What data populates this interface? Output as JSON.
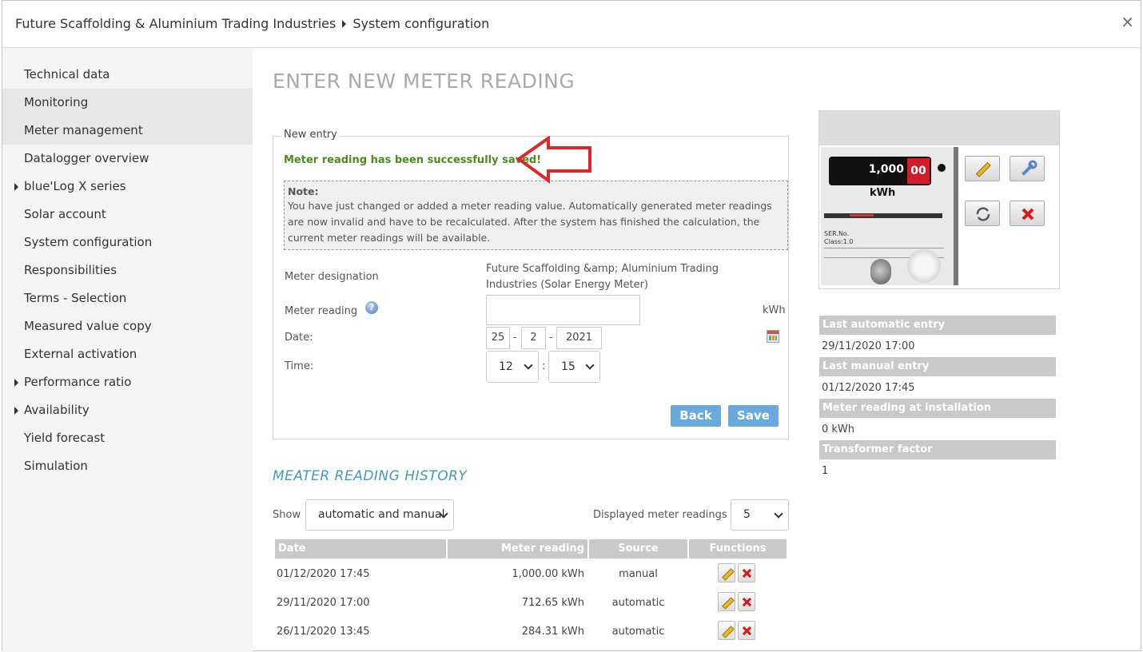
{
  "header": {
    "company": "Future Scaffolding & Aluminium Trading Industries",
    "page": "System configuration",
    "close": "×"
  },
  "sidebar": {
    "items": [
      {
        "label": "Technical data",
        "arrow": false
      },
      {
        "label": "Monitoring",
        "arrow": false
      },
      {
        "label": "Meter management",
        "arrow": false
      },
      {
        "label": "Datalogger overview",
        "arrow": false
      },
      {
        "label": "blue'Log X series",
        "arrow": true
      },
      {
        "label": "Solar account",
        "arrow": false
      },
      {
        "label": "System configuration",
        "arrow": false
      },
      {
        "label": "Responsibilities",
        "arrow": false
      },
      {
        "label": "Terms - Selection",
        "arrow": false
      },
      {
        "label": "Measured value copy",
        "arrow": false
      },
      {
        "label": "External activation",
        "arrow": false
      },
      {
        "label": "Performance ratio",
        "arrow": true
      },
      {
        "label": "Availability",
        "arrow": true
      },
      {
        "label": "Yield forecast",
        "arrow": false
      },
      {
        "label": "Simulation",
        "arrow": false
      }
    ]
  },
  "main": {
    "title": "ENTER NEW METER READING",
    "legend": "New entry",
    "success": "Meter reading has been successfully saved!",
    "note_title": "Note:",
    "note_text": "You have just changed or added a meter reading value. Automatically generated meter readings are now invalid and have to be recalculated. After the system has finished the calculation, the current meter readings will be available.",
    "designation_label": "Meter designation",
    "designation_value": "Future Scaffolding &amp; Aluminium Trading Industries (Solar Energy Meter)",
    "reading_label": "Meter reading",
    "reading_value": "",
    "help_glyph": "?",
    "unit": "kWh",
    "date_label": "Date:",
    "date_day": "25",
    "date_month": "2",
    "date_year": "2021",
    "date_sep": "-",
    "time_label": "Time:",
    "time_hour": "12",
    "time_min": "15",
    "time_sep": ":",
    "back": "Back",
    "save": "Save"
  },
  "history": {
    "title": "MEATER READING HISTORY",
    "show_label": "Show",
    "show_value": "automatic and manual",
    "displayed_label": "Displayed meter readings",
    "displayed_value": "5",
    "columns": [
      "Date",
      "Meter reading",
      "Source",
      "Functions"
    ],
    "rows": [
      {
        "date": "01/12/2020 17:45",
        "reading": "1,000.00 kWh",
        "source": "manual"
      },
      {
        "date": "29/11/2020 17:00",
        "reading": "712.65 kWh",
        "source": "automatic"
      },
      {
        "date": "26/11/2020 13:45",
        "reading": "284.31 kWh",
        "source": "automatic"
      }
    ]
  },
  "meter": {
    "display_int": "1,000",
    "display_dec": "00",
    "unit": "kWh",
    "ser": "SER.No.",
    "class": "Class:1.0"
  },
  "info": [
    {
      "label": "Last automatic entry",
      "value": "29/11/2020 17:00"
    },
    {
      "label": "Last manual entry",
      "value": "01/12/2020 17:45"
    },
    {
      "label": "Meter reading at installation",
      "value": "0 kWh"
    },
    {
      "label": "Transformer factor",
      "value": "1"
    }
  ],
  "colors": {
    "accent": "#6aa9dc",
    "success": "#4d8a1f",
    "history_title": "#3d9bbf",
    "annotation_arrow": "#e0262a"
  }
}
